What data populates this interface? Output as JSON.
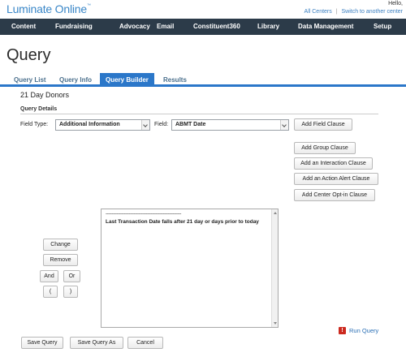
{
  "header": {
    "logo": "Luminate Online",
    "logo_mark": "™",
    "greeting": "Hello,",
    "links": [
      "All Centers",
      "Switch to another center"
    ],
    "link_separator": "|"
  },
  "nav": {
    "items": [
      "Content",
      "Fundraising",
      "Advocacy",
      "Email",
      "Constituent360",
      "Library",
      "Data Management",
      "Setup"
    ]
  },
  "page": {
    "title": "Query",
    "tabs": [
      {
        "label": "Query List",
        "active": false
      },
      {
        "label": "Query Info",
        "active": false
      },
      {
        "label": "Query Builder",
        "active": true
      },
      {
        "label": "Results",
        "active": false
      }
    ],
    "query_name": "21 Day Donors",
    "details_heading": "Query Details"
  },
  "builder": {
    "field_type_label": "Field Type:",
    "field_type_value": "Additional Information",
    "field_label": "Field:",
    "field_value": "ABMT Date",
    "add_field_clause": "Add Field Clause",
    "add_group_clause": "Add Group Clause",
    "add_interaction_clause": "Add an Interaction Clause",
    "add_action_alert_clause": "Add an Action Alert Clause",
    "add_center_optin_clause": "Add Center Opt-in Clause",
    "clause_separator": "--------------------------------------------------------------",
    "clause_text": "Last Transaction Date falls after 21 day or days prior to today",
    "change": "Change",
    "remove": "Remove",
    "and": "And",
    "or": "Or",
    "open_paren": "(",
    "close_paren": ")"
  },
  "footer": {
    "run_query": "Run Query",
    "run_icon": "!",
    "save_query": "Save Query",
    "save_query_as": "Save Query As",
    "cancel": "Cancel"
  },
  "colors": {
    "nav_bg": "#2c3b49",
    "accent": "#2b77c9",
    "logo": "#3a87c8",
    "run_icon": "#cc2a1f"
  }
}
